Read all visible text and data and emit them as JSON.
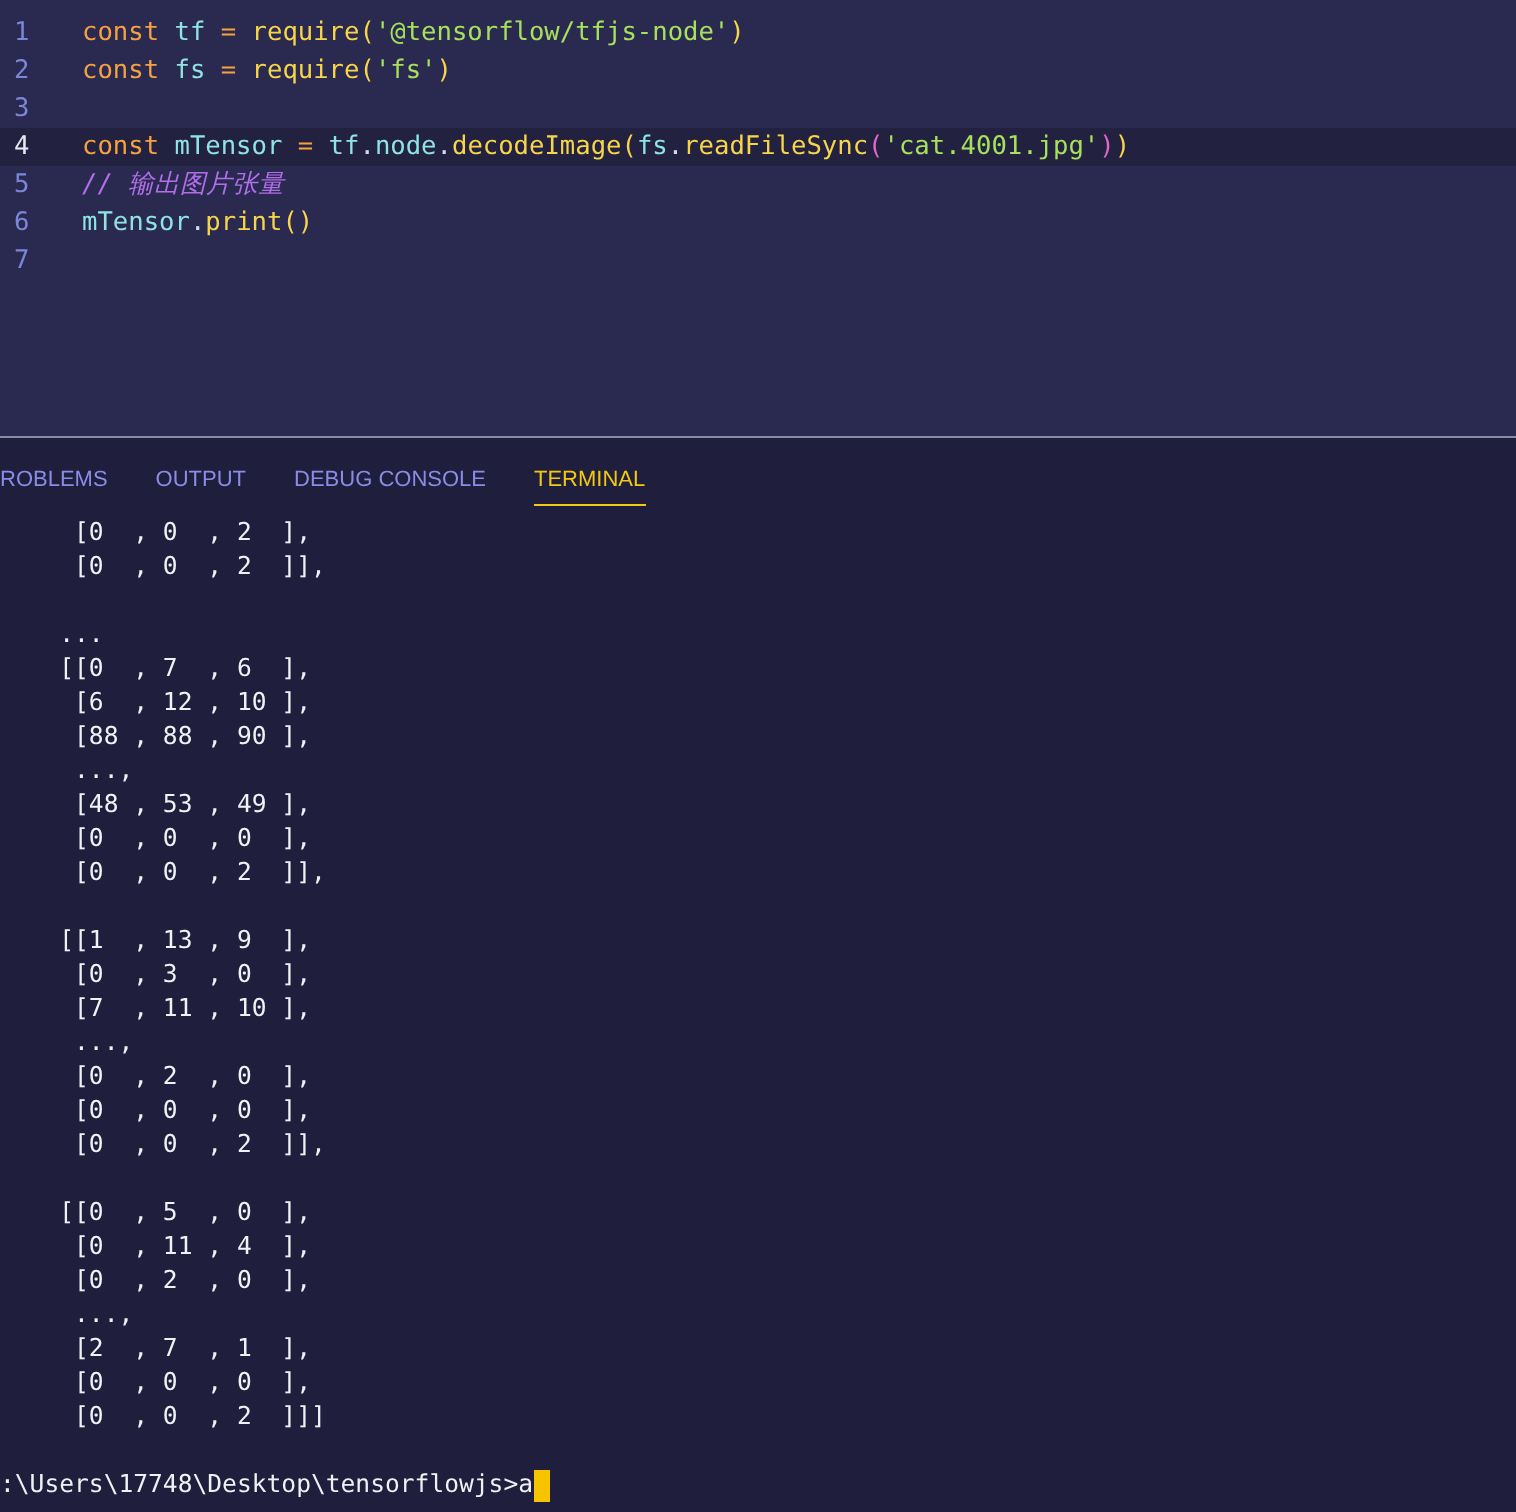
{
  "editor": {
    "lines": [
      {
        "number": "1",
        "current": false,
        "tokens": [
          {
            "kind": "keyword",
            "text": "const"
          },
          {
            "kind": "variable",
            "text": " tf"
          },
          {
            "kind": "operator",
            "text": " ="
          },
          {
            "kind": "function",
            "text": " require"
          },
          {
            "kind": "paren",
            "text": "("
          },
          {
            "kind": "string",
            "text": "'@tensorflow/tfjs-node'"
          },
          {
            "kind": "paren",
            "text": ")"
          }
        ]
      },
      {
        "number": "2",
        "current": false,
        "tokens": [
          {
            "kind": "keyword",
            "text": "const"
          },
          {
            "kind": "variable",
            "text": " fs"
          },
          {
            "kind": "operator",
            "text": " ="
          },
          {
            "kind": "function",
            "text": " require"
          },
          {
            "kind": "paren",
            "text": "("
          },
          {
            "kind": "string",
            "text": "'fs'"
          },
          {
            "kind": "paren",
            "text": ")"
          }
        ]
      },
      {
        "number": "3",
        "current": false
      },
      {
        "number": "4",
        "current": true,
        "tokens": [
          {
            "kind": "keyword",
            "text": "const"
          },
          {
            "kind": "variable",
            "text": " mTensor"
          },
          {
            "kind": "operator",
            "text": " ="
          },
          {
            "kind": "variable",
            "text": " tf"
          },
          {
            "kind": "plain",
            "text": "."
          },
          {
            "kind": "variable",
            "text": "node"
          },
          {
            "kind": "plain",
            "text": "."
          },
          {
            "kind": "function",
            "text": "decodeImage"
          },
          {
            "kind": "paren",
            "text": "("
          },
          {
            "kind": "variable",
            "text": "fs"
          },
          {
            "kind": "plain",
            "text": "."
          },
          {
            "kind": "function",
            "text": "readFileSync"
          },
          {
            "kind": "paren2",
            "text": "("
          },
          {
            "kind": "string",
            "text": "'cat.4001.jpg'"
          },
          {
            "kind": "paren2",
            "text": ")"
          },
          {
            "kind": "paren",
            "text": ")"
          }
        ]
      },
      {
        "number": "5",
        "current": false,
        "tokens": [
          {
            "kind": "comment",
            "text": "// 输出图片张量"
          }
        ]
      },
      {
        "number": "6",
        "current": false,
        "tokens": [
          {
            "kind": "variable",
            "text": "mTensor"
          },
          {
            "kind": "plain",
            "text": "."
          },
          {
            "kind": "function",
            "text": "print"
          },
          {
            "kind": "paren",
            "text": "()"
          }
        ]
      },
      {
        "number": "7",
        "current": false
      }
    ]
  },
  "panel": {
    "tabs": [
      {
        "label": "ROBLEMS",
        "selected": false
      },
      {
        "label": "OUTPUT",
        "selected": false
      },
      {
        "label": "DEBUG CONSOLE",
        "selected": false
      },
      {
        "label": "TERMINAL",
        "selected": true
      }
    ]
  },
  "terminal": {
    "blocks": [
      {
        "lines": [
          "     [0  , 0  , 2  ],",
          "     [0  , 0  , 2  ]],"
        ]
      },
      {
        "lines": [
          "    ...",
          "    [[0  , 7  , 6  ],",
          "     [6  , 12 , 10 ],",
          "     [88 , 88 , 90 ],",
          "     ...,",
          "     [48 , 53 , 49 ],",
          "     [0  , 0  , 0  ],",
          "     [0  , 0  , 2  ]],"
        ]
      },
      {
        "lines": [
          "    [[1  , 13 , 9  ],",
          "     [0  , 3  , 0  ],",
          "     [7  , 11 , 10 ],",
          "     ...,",
          "     [0  , 2  , 0  ],",
          "     [0  , 0  , 0  ],",
          "     [0  , 0  , 2  ]],"
        ]
      },
      {
        "lines": [
          "    [[0  , 5  , 0  ],",
          "     [0  , 11 , 4  ],",
          "     [0  , 2  , 0  ],",
          "     ...,",
          "     [2  , 7  , 1  ],",
          "     [0  , 0  , 0  ],",
          "     [0  , 0  , 2  ]]]"
        ]
      }
    ],
    "prompt": ":\\Users\\17748\\Desktop\\tensorflowjs>a"
  }
}
